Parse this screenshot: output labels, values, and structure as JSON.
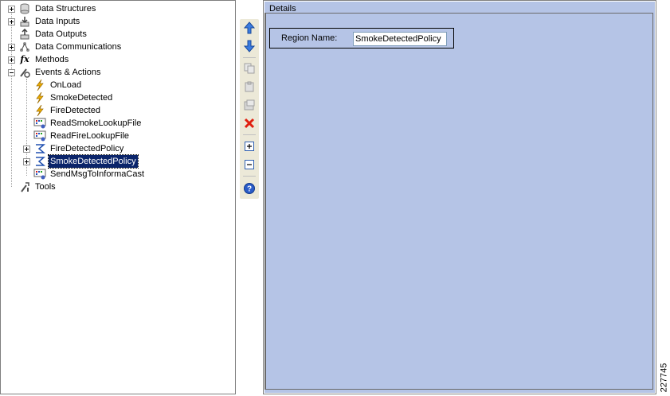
{
  "tree": {
    "items": [
      {
        "label": "Data Structures",
        "icon": "database-icon",
        "expander": "plus",
        "level": 0
      },
      {
        "label": "Data Inputs",
        "icon": "data-input-icon",
        "expander": "plus",
        "level": 0
      },
      {
        "label": "Data Outputs",
        "icon": "data-output-icon",
        "expander": "none",
        "level": 0
      },
      {
        "label": "Data Communications",
        "icon": "network-icon",
        "expander": "plus",
        "level": 0
      },
      {
        "label": "Methods",
        "icon": "function-icon",
        "expander": "plus",
        "level": 0
      },
      {
        "label": "Events & Actions",
        "icon": "events-actions-icon",
        "expander": "minus",
        "level": 0
      },
      {
        "label": "OnLoad",
        "icon": "lightning-icon",
        "expander": "none",
        "level": 1
      },
      {
        "label": "SmokeDetected",
        "icon": "lightning-icon",
        "expander": "none",
        "level": 1
      },
      {
        "label": "FireDetected",
        "icon": "lightning-icon",
        "expander": "none",
        "level": 1
      },
      {
        "label": "ReadSmokeLookupFile",
        "icon": "action-icon",
        "expander": "none",
        "level": 1
      },
      {
        "label": "ReadFireLookupFile",
        "icon": "action-icon",
        "expander": "none",
        "level": 1
      },
      {
        "label": "FireDetectedPolicy",
        "icon": "policy-icon",
        "expander": "plus",
        "level": 1
      },
      {
        "label": "SmokeDetectedPolicy",
        "icon": "policy-icon",
        "expander": "plus",
        "level": 1,
        "selected": true
      },
      {
        "label": "SendMsgToInformaCast",
        "icon": "action-icon",
        "expander": "none",
        "level": 1
      },
      {
        "label": "Tools",
        "icon": "tools-icon",
        "expander": "none",
        "level": 0
      }
    ]
  },
  "toolbar": {
    "buttons": [
      {
        "name": "move-up-button",
        "icon": "arrow-up-icon"
      },
      {
        "name": "move-down-button",
        "icon": "arrow-down-icon"
      },
      {
        "name": "copy-button",
        "icon": "copy-icon"
      },
      {
        "name": "paste-button",
        "icon": "paste-icon"
      },
      {
        "name": "paste-special-button",
        "icon": "paste-special-icon"
      },
      {
        "name": "delete-button",
        "icon": "delete-icon"
      },
      {
        "name": "expand-all-button",
        "icon": "expand-icon"
      },
      {
        "name": "collapse-all-button",
        "icon": "collapse-icon"
      },
      {
        "name": "help-button",
        "icon": "help-icon"
      }
    ]
  },
  "details": {
    "title": "Details",
    "region_label": "Region Name:",
    "region_value": "SmokeDetectedPolicy"
  },
  "figure_number": "227745",
  "colors": {
    "details_background": "#b5c4e6",
    "selection": "#0a246a",
    "toolbar": "#ece9d8"
  }
}
